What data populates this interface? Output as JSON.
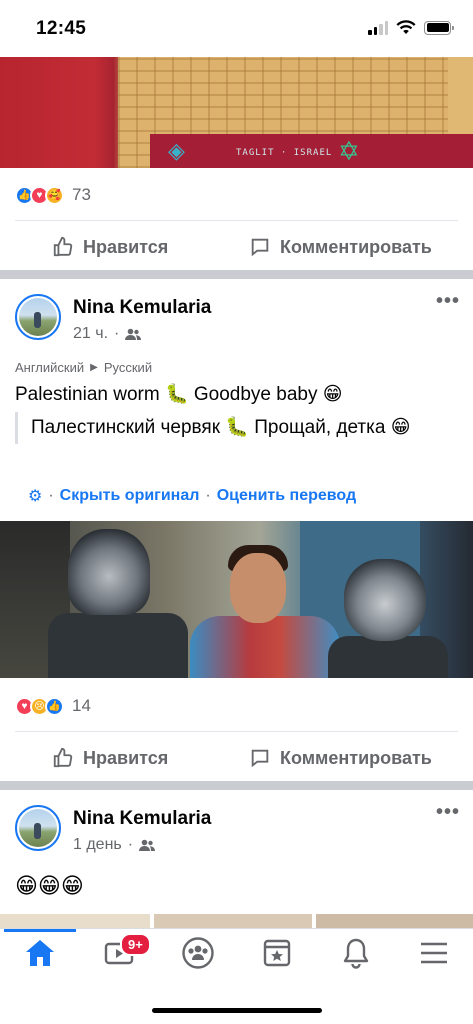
{
  "status_bar": {
    "time": "12:45"
  },
  "post1": {
    "reaction_count": "73",
    "like_label": "Нравится",
    "comment_label": "Комментировать"
  },
  "post2": {
    "author": "Nina Kemularia",
    "time": "21 ч.",
    "lang_from": "Английский",
    "lang_to": "Русский",
    "text": "Palestinian worm 🐛 Goodbye baby 😁",
    "translation": "Палестинский червяк 🐛 Прощай, детка 😁",
    "hide_original": "Скрыть оригинал",
    "rate_translation": "Оценить перевод",
    "reaction_count": "14",
    "like_label": "Нравится",
    "comment_label": "Комментировать"
  },
  "post3": {
    "author": "Nina Kemularia",
    "time": "1 день",
    "text": "😁😁😁"
  },
  "bottom_nav": {
    "watch_badge": "9+",
    "items": [
      "home-icon",
      "watch-icon",
      "groups-icon",
      "marketplace-icon",
      "bell-icon",
      "menu-icon"
    ],
    "active": "home",
    "accent": "#1877f2"
  }
}
